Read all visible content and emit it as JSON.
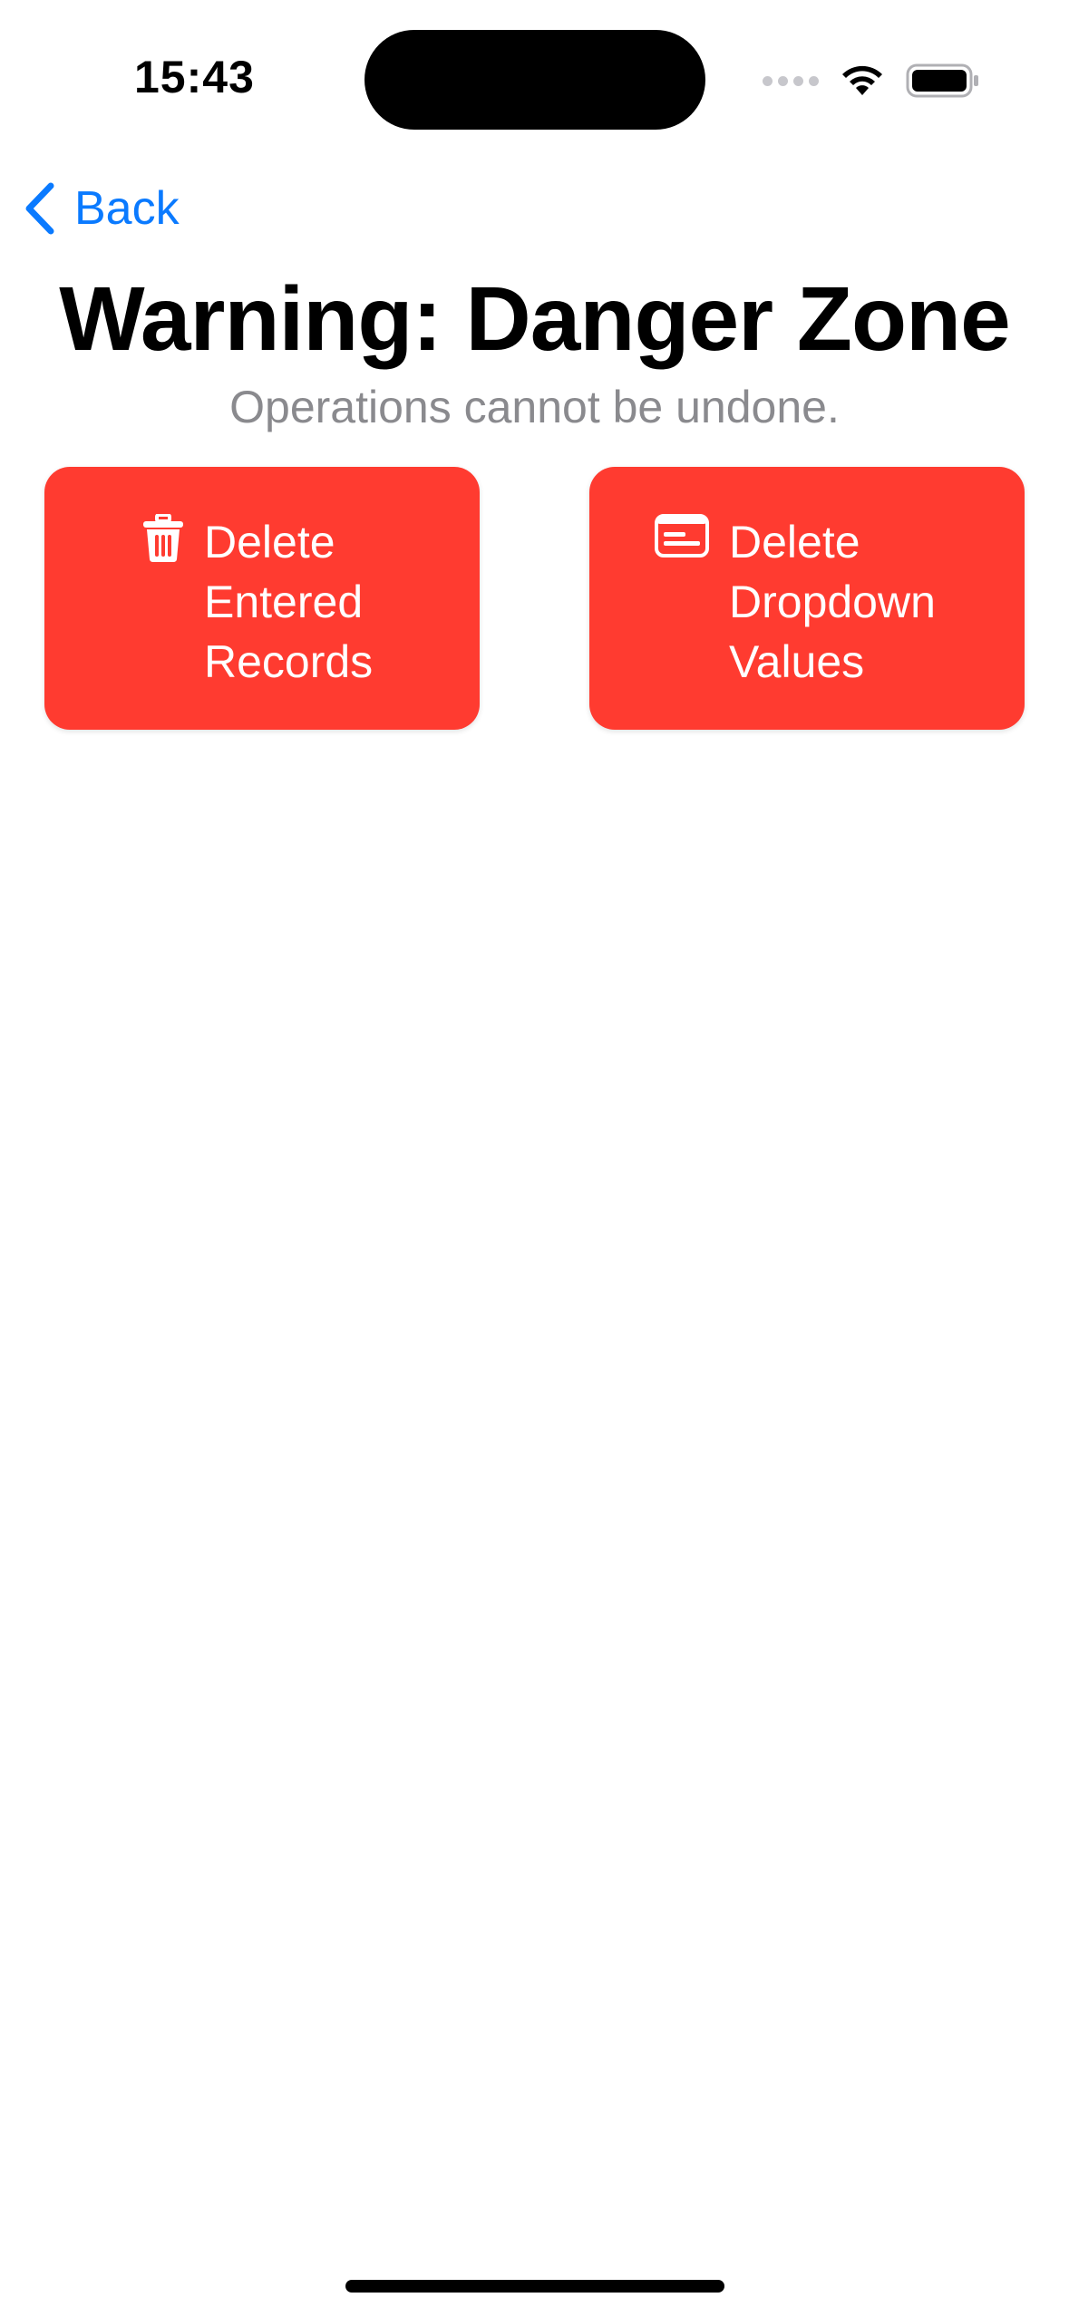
{
  "status_bar": {
    "time": "15:43",
    "icons": [
      "signal-dots-icon",
      "wifi-icon",
      "battery-icon"
    ]
  },
  "nav": {
    "back_label": "Back",
    "back_icon": "chevron-left-icon",
    "accent_color": "#0a7aff"
  },
  "header": {
    "title": "Warning: Danger Zone",
    "subtitle": "Operations cannot be undone."
  },
  "actions": [
    {
      "icon": "trash-icon",
      "label_lines": [
        "Delete",
        "Entered",
        "Records"
      ],
      "color": "#ff3b30"
    },
    {
      "icon": "list-card-icon",
      "label_lines": [
        "Delete",
        "Dropdown",
        "Values"
      ],
      "color": "#ff3b30"
    }
  ]
}
